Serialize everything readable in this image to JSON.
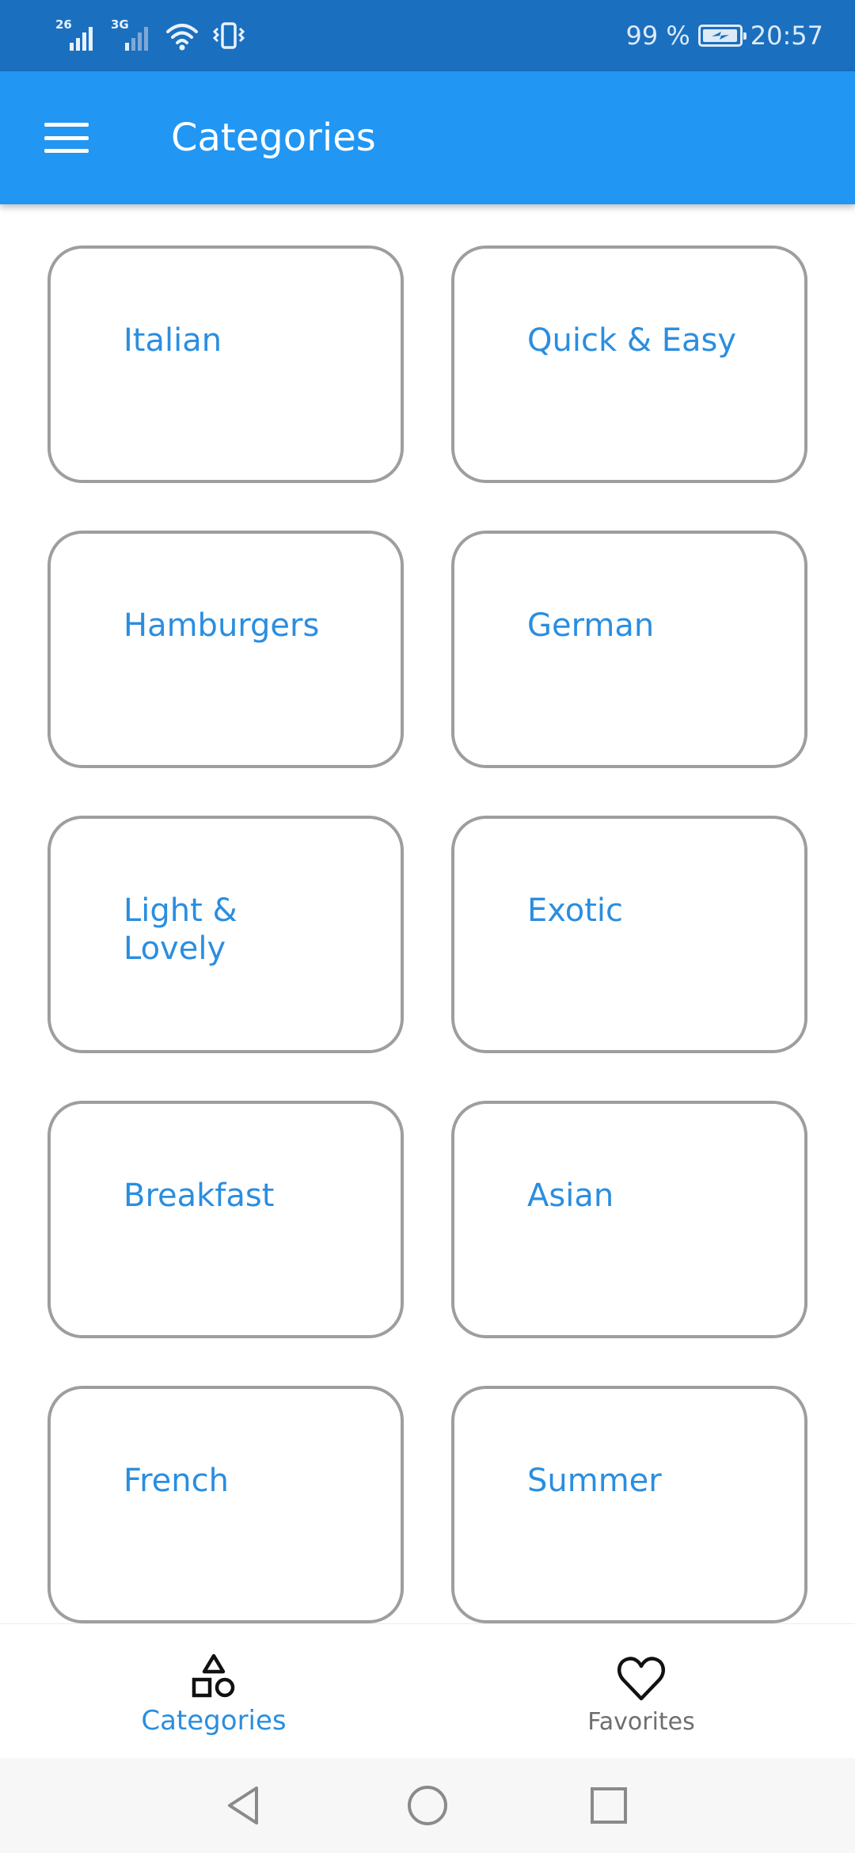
{
  "status_bar": {
    "network_1": "26",
    "network_2": "3G",
    "battery_percent_text": "99 %",
    "time": "20:57",
    "battery_level": 0.99
  },
  "app_bar": {
    "title": "Categories"
  },
  "categories": [
    {
      "label": "Italian"
    },
    {
      "label": "Quick & Easy"
    },
    {
      "label": "Hamburgers"
    },
    {
      "label": "German"
    },
    {
      "label": "Light & Lovely"
    },
    {
      "label": "Exotic"
    },
    {
      "label": "Breakfast"
    },
    {
      "label": "Asian"
    },
    {
      "label": "French"
    },
    {
      "label": "Summer"
    }
  ],
  "bottom_nav": {
    "items": [
      {
        "label": "Categories",
        "icon": "shapes-icon",
        "active": true
      },
      {
        "label": "Favorites",
        "icon": "heart-outline-icon",
        "active": false
      }
    ]
  },
  "system_nav": {
    "icons": [
      "back-triangle-icon",
      "home-circle-icon",
      "recents-square-icon"
    ]
  },
  "colors": {
    "status_bar": "#1a6fbf",
    "app_bar": "#2196f3",
    "accent_text": "#2a8ee0",
    "card_border": "#9e9e9e"
  }
}
